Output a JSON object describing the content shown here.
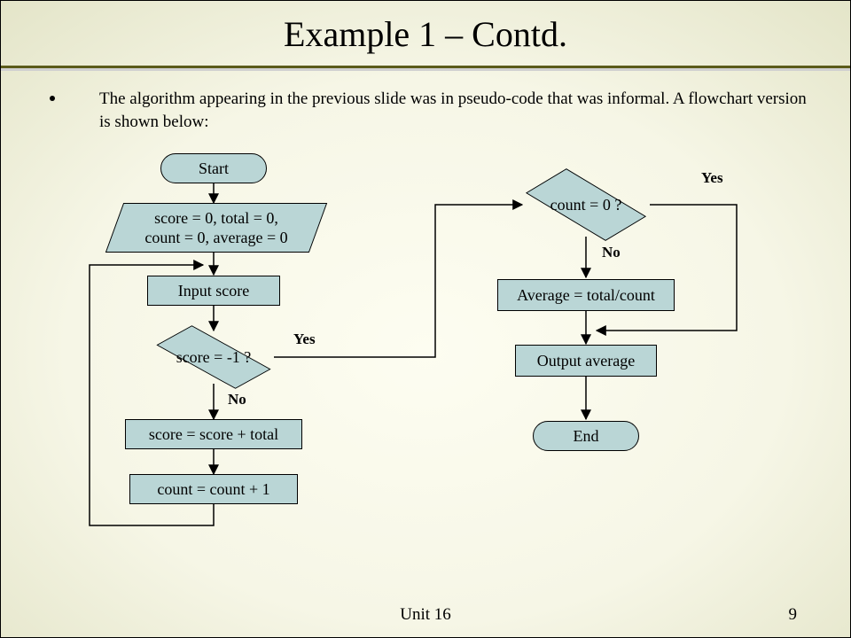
{
  "title": "Example 1 – Contd.",
  "bullet": "The algorithm appearing in the previous slide was in pseudo-code that was informal. A flowchart version is shown below:",
  "footer_unit": "Unit 16",
  "footer_page": "9",
  "nodes": {
    "start": "Start",
    "init_line1": "score = 0, total = 0,",
    "init_line2": "count = 0, average = 0",
    "input": "Input score",
    "dec1": "score = -1 ?",
    "proc1": "score = score + total",
    "proc2": "count = count + 1",
    "dec2": "count = 0 ?",
    "avg": "Average = total/count",
    "out": "Output average",
    "end": "End"
  },
  "labels": {
    "yes": "Yes",
    "no": "No"
  }
}
